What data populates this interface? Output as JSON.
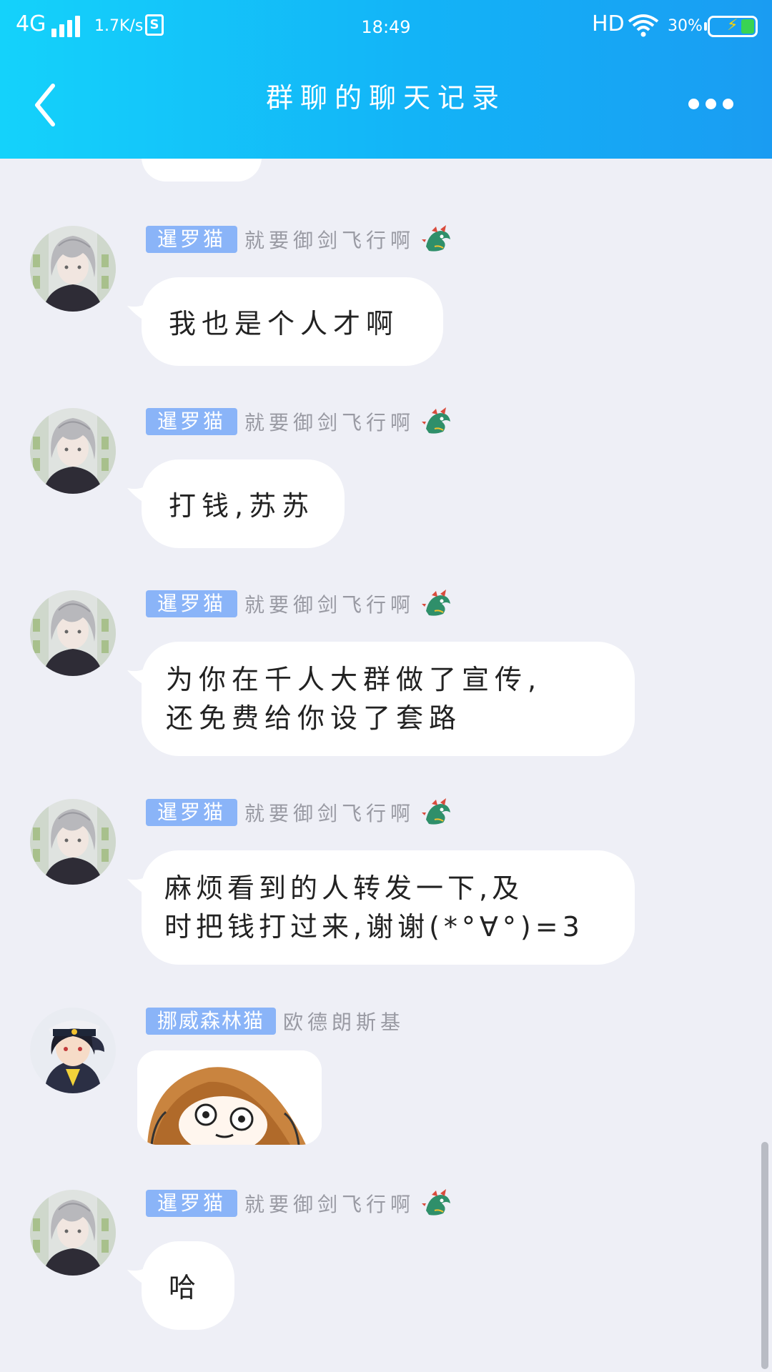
{
  "status_bar": {
    "network": "4G",
    "speed": "1.7K/s",
    "s_icon": "S",
    "time": "18:49",
    "hd": "HD",
    "battery_pct": "30%",
    "battery_level": 0.3
  },
  "header": {
    "title": "群聊的聊天记录"
  },
  "messages": [
    {
      "title": "暹罗猫",
      "nick": "就要御剑飞行啊",
      "text": "我也是个人才啊",
      "avatar": "grey-hair-avatar"
    },
    {
      "title": "暹罗猫",
      "nick": "就要御剑飞行啊",
      "text": "打钱,苏苏",
      "avatar": "grey-hair-avatar"
    },
    {
      "title": "暹罗猫",
      "nick": "就要御剑飞行啊",
      "line1": "为你在千人大群做了宣传,",
      "line2": "还免费给你设了套路",
      "avatar": "grey-hair-avatar"
    },
    {
      "title": "暹罗猫",
      "nick": "就要御剑飞行啊",
      "line1": "麻烦看到的人转发一下,及",
      "line2": "时把钱打过来,谢谢(*°∀°)=3",
      "avatar": "grey-hair-avatar"
    },
    {
      "title": "挪威森林猫",
      "nick": "欧德朗斯基",
      "sticker": "umaru-sticker",
      "avatar": "officer-girl-avatar"
    },
    {
      "title": "暹罗猫",
      "nick": "就要御剑飞行啊",
      "text": "哈",
      "avatar": "grey-hair-avatar"
    }
  ],
  "icons": {
    "level": "dragon-icon",
    "back": "chevron-left-icon",
    "more": "more-dots-icon"
  }
}
